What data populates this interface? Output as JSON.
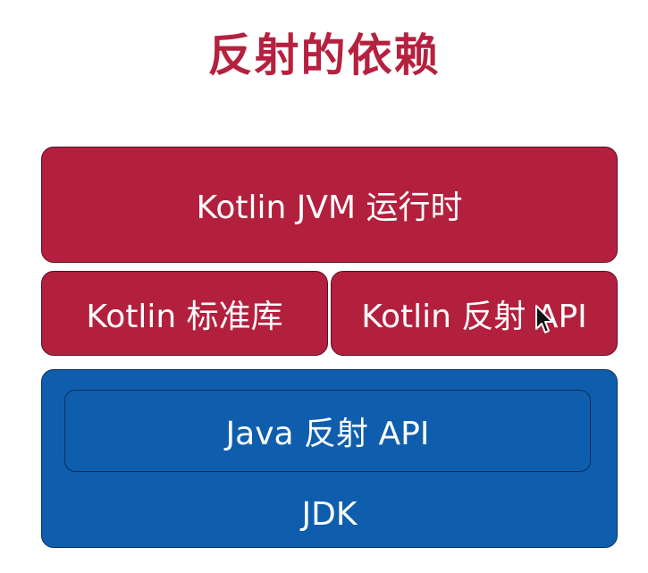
{
  "title": "反射的依赖",
  "layers": {
    "runtime": "Kotlin JVM 运行时",
    "stdlib": "Kotlin 标准库",
    "kotlin_reflect": "Kotlin 反射 API",
    "java_reflect": "Java 反射 API",
    "jdk": "JDK"
  },
  "colors": {
    "title": "#b5213f",
    "red_box": "#b3203e",
    "blue_box": "#0f5eae"
  },
  "icons": [
    "mouse-pointer-icon"
  ]
}
